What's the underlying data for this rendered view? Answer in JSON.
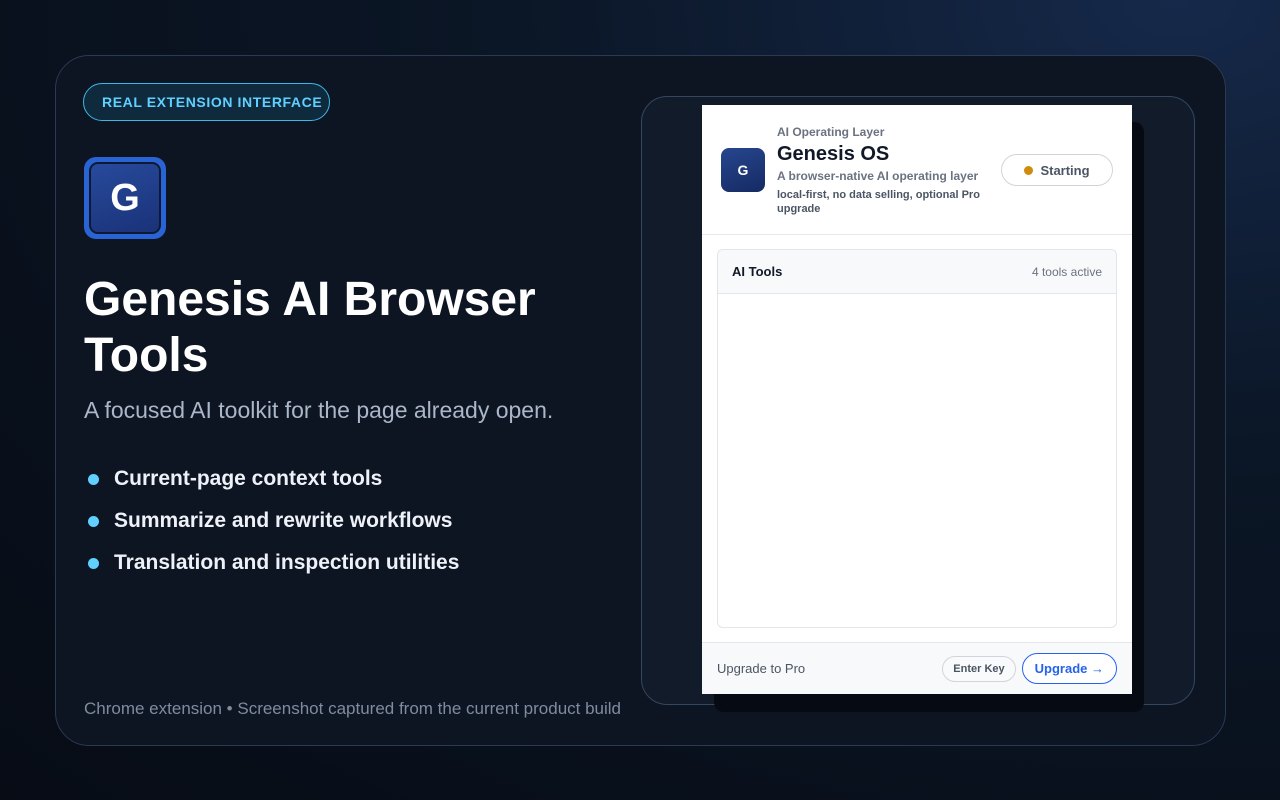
{
  "colors": {
    "accent": "#5fd0ff",
    "brand_blue": "#2563eb",
    "status_amber": "#d08a0c",
    "background": "#0d1422"
  },
  "hero": {
    "pill_label": "REAL EXTENSION INTERFACE",
    "logo_letter": "G",
    "title": "Genesis AI Browser Tools",
    "subtitle": "A focused AI toolkit for the page already open.",
    "features": [
      "Current-page context tools",
      "Summarize and rewrite workflows",
      "Translation and inspection utilities"
    ],
    "footnote": "Chrome extension • Screenshot captured from the current product build"
  },
  "popup": {
    "icon_letter": "G",
    "eyebrow": "AI Operating Layer",
    "title": "Genesis OS",
    "description": "A browser-native AI operating layer",
    "meta": "local-first, no data selling, optional Pro upgrade",
    "status_label": "Starting",
    "tools": {
      "title": "AI Tools",
      "count": "4 tools active"
    },
    "footer": {
      "upgrade_text": "Upgrade to Pro",
      "enter_key_label": "Enter Key",
      "upgrade_label": "Upgrade →"
    }
  }
}
